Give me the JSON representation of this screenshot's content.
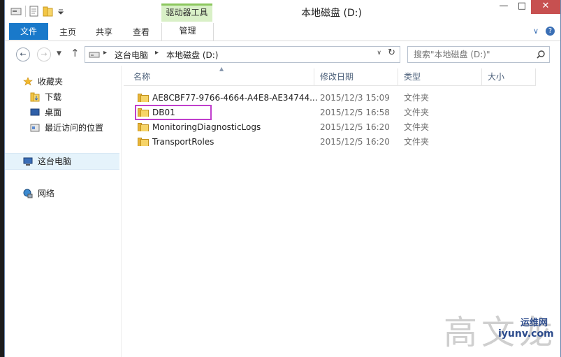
{
  "window": {
    "title": "本地磁盘 (D:)",
    "context_tab_group": "驱动器工具"
  },
  "ribbon": {
    "tabs": [
      {
        "label": "文件"
      },
      {
        "label": "主页"
      },
      {
        "label": "共享"
      },
      {
        "label": "查看"
      },
      {
        "label": "管理"
      }
    ]
  },
  "address": {
    "segments": [
      "这台电脑",
      "本地磁盘 (D:)"
    ]
  },
  "search": {
    "placeholder": "搜索\"本地磁盘 (D:)\""
  },
  "navpane": {
    "favorites": "收藏夹",
    "downloads": "下载",
    "desktop": "桌面",
    "recent": "最近访问的位置",
    "this_pc": "这台电脑",
    "network": "网络"
  },
  "columns": {
    "name": "名称",
    "modified": "修改日期",
    "type": "类型",
    "size": "大小"
  },
  "files": [
    {
      "name": "AE8CBF77-9766-4664-A4E8-AE34744...",
      "date": "2015/12/3 15:09",
      "type": "文件夹"
    },
    {
      "name": "DB01",
      "date": "2015/12/5 16:58",
      "type": "文件夹"
    },
    {
      "name": "MonitoringDiagnosticLogs",
      "date": "2015/12/5 16:20",
      "type": "文件夹"
    },
    {
      "name": "TransportRoles",
      "date": "2015/12/5 16:20",
      "type": "文件夹"
    }
  ],
  "watermark": {
    "text": "高文龙",
    "site_name": "运维网",
    "site_url": "iyunv.com"
  },
  "colors": {
    "accent": "#1979ca",
    "highlight_box": "#c03ecc",
    "context_tab": "#d9f0c7"
  }
}
